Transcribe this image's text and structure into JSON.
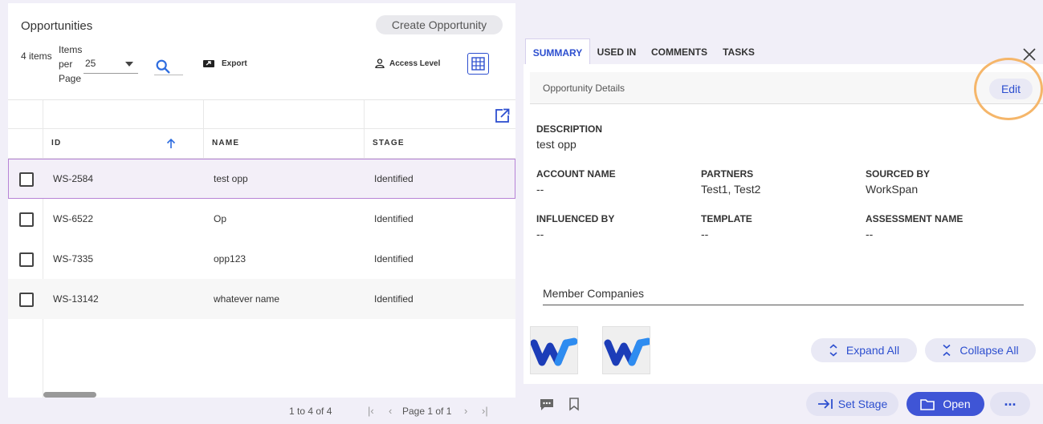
{
  "left": {
    "title": "Opportunities",
    "create_label": "Create Opportunity",
    "items_count": "4 items",
    "items_per_page_label": "Items per Page",
    "items_per_page_value": "25",
    "export_label": "Export",
    "access_label": "Access Level"
  },
  "table": {
    "columns": [
      "ID",
      "NAME",
      "STAGE"
    ],
    "rows": [
      {
        "id": "WS-2584",
        "name": "test opp",
        "stage": "Identified"
      },
      {
        "id": "WS-6522",
        "name": "Op",
        "stage": "Identified"
      },
      {
        "id": "WS-7335",
        "name": "opp123",
        "stage": "Identified"
      },
      {
        "id": "WS-13142",
        "name": "whatever name",
        "stage": "Identified"
      }
    ]
  },
  "pager": {
    "range": "1 to 4 of 4",
    "page": "Page 1 of 1"
  },
  "right": {
    "tabs": [
      "SUMMARY",
      "USED IN",
      "COMMENTS",
      "TASKS"
    ],
    "active_tab": "SUMMARY",
    "details_title": "Opportunity Details",
    "edit_label": "Edit",
    "fields": {
      "description": {
        "label": "DESCRIPTION",
        "value": "test opp"
      },
      "account_name": {
        "label": "ACCOUNT NAME",
        "value": "--"
      },
      "partners": {
        "label": "PARTNERS",
        "value": "Test1, Test2"
      },
      "sourced_by": {
        "label": "SOURCED BY",
        "value": "WorkSpan"
      },
      "influenced_by": {
        "label": "INFLUENCED BY",
        "value": "--"
      },
      "template": {
        "label": "TEMPLATE",
        "value": "--"
      },
      "assessment_name": {
        "label": "ASSESSMENT NAME",
        "value": "--"
      }
    },
    "member_companies_title": "Member Companies",
    "expand_all_label": "Expand All",
    "collapse_all_label": "Collapse All",
    "set_stage_label": "Set Stage",
    "open_label": "Open",
    "more_label": "..."
  },
  "colors": {
    "accent": "#2d4fcf",
    "primary_button": "#3f55d6",
    "highlight_ring": "#f5b66a",
    "selected_row_border": "#b783d6"
  }
}
